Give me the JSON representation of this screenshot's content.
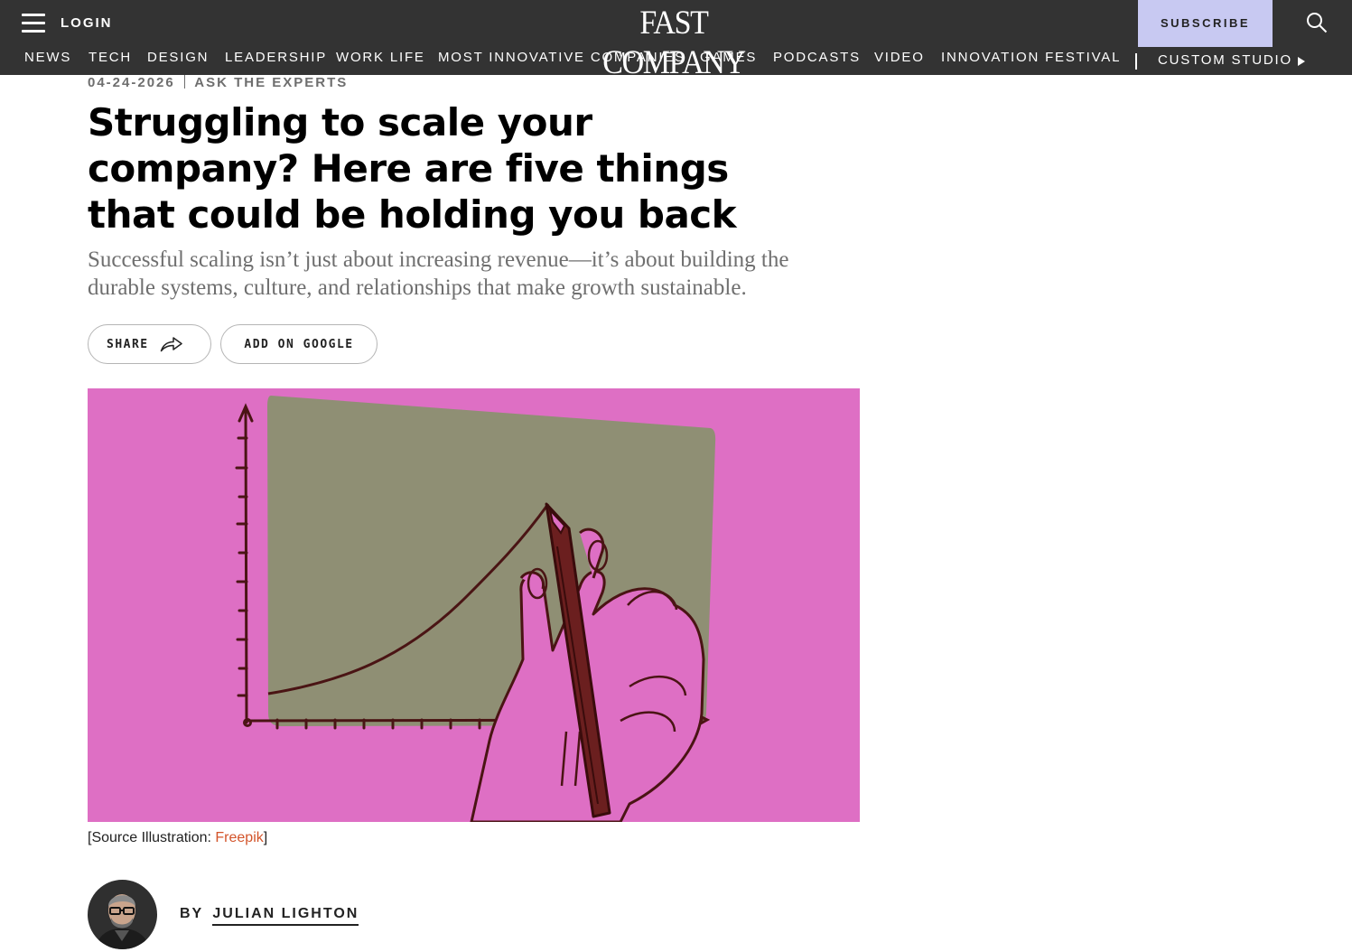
{
  "header": {
    "login_label": "LOGIN",
    "logo_text": "FAST COMPANY",
    "subscribe_label": "SUBSCRIBE",
    "nav": [
      {
        "label": "NEWS"
      },
      {
        "label": "TECH"
      },
      {
        "label": "DESIGN"
      },
      {
        "label": "LEADERSHIP"
      },
      {
        "label": "WORK LIFE"
      },
      {
        "label": "MOST INNOVATIVE COMPANIES"
      },
      {
        "label": "GAMES"
      },
      {
        "label": "PODCASTS"
      },
      {
        "label": "VIDEO"
      },
      {
        "label": "INNOVATION FESTIVAL"
      }
    ],
    "custom_studio_label": "CUSTOM STUDIO",
    "icons": {
      "menu": "hamburger-menu-icon",
      "search": "search-icon",
      "arrow": "play-arrow-icon"
    }
  },
  "article": {
    "date": "04-24-2026",
    "category": "ASK THE EXPERTS",
    "headline": "Struggling to scale your company? Here are five things that could be holding you back",
    "dek": "Successful scaling isn’t just about increasing revenue—it’s about building the durable systems, culture, and relationships that make growth sustainable.",
    "share_label": "SHARE",
    "google_label": "ADD ON GOOGLE",
    "caption_prefix": "[Source Illustration: ",
    "caption_link": "Freepik",
    "caption_suffix": "]",
    "byline_prefix": "BY",
    "author": "JULIAN LIGHTON"
  },
  "colors": {
    "header_bg": "#333333",
    "subscribe_bg": "#c8c9f2",
    "hero_pink": "#de6fc4",
    "hero_olive": "#8f8f74",
    "ink": "#4a1414",
    "link": "#d3542a"
  }
}
